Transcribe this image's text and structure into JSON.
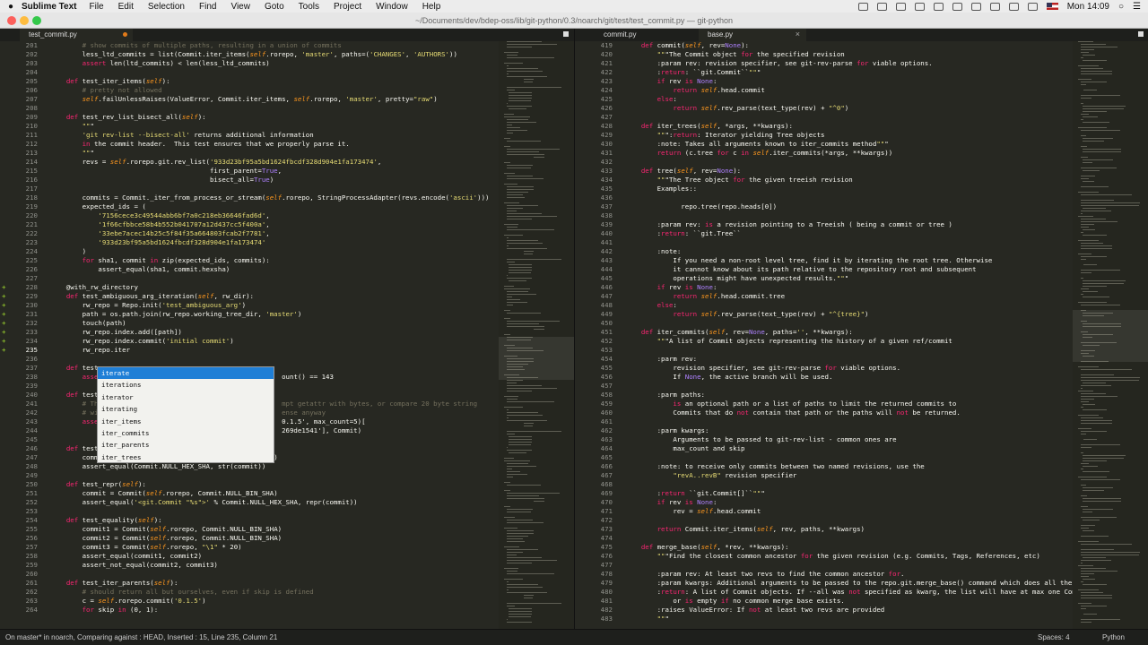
{
  "menubar": {
    "app_name": "Sublime Text",
    "items": [
      "File",
      "Edit",
      "Selection",
      "Find",
      "View",
      "Goto",
      "Tools",
      "Project",
      "Window",
      "Help"
    ],
    "clock": "Mon 14:09"
  },
  "window": {
    "title": "~/Documents/dev/bdep-oss/lib/git-python/0.3/noarch/git/test/test_commit.py — git-python"
  },
  "left_pane": {
    "tab": "test_commit.py",
    "lines": [
      [
        "201",
        "        # show commits of multiple paths, resulting in a union of commits",
        ""
      ],
      [
        "202",
        "        less_ltd_commits = list(Commit.iter_items(self.rorepo, 'master', paths=('CHANGES', 'AUTHORS'))",
        ""
      ],
      [
        "203",
        "        assert len(ltd_commits) < len(less_ltd_commits)",
        ""
      ],
      [
        "204",
        "",
        ""
      ],
      [
        "205",
        "    def test_iter_items(self):",
        ""
      ],
      [
        "206",
        "        # pretty not allowed",
        ""
      ],
      [
        "207",
        "        self.failUnlessRaises(ValueError, Commit.iter_items, self.rorepo, 'master', pretty=\"raw\")",
        ""
      ],
      [
        "208",
        "",
        ""
      ],
      [
        "209",
        "    def test_rev_list_bisect_all(self):",
        ""
      ],
      [
        "210",
        "        \"\"\"",
        ""
      ],
      [
        "211",
        "        'git rev-list --bisect-all' returns additional information",
        ""
      ],
      [
        "212",
        "        in the commit header.  This test ensures that we properly parse it.",
        ""
      ],
      [
        "213",
        "        \"\"\"",
        ""
      ],
      [
        "214",
        "        revs = self.rorepo.git.rev_list('933d23bf95a5bd1624fbcdf328d904e1fa173474',",
        ""
      ],
      [
        "215",
        "                                        first_parent=True,",
        ""
      ],
      [
        "216",
        "                                        bisect_all=True)",
        ""
      ],
      [
        "217",
        "",
        ""
      ],
      [
        "218",
        "        commits = Commit._iter_from_process_or_stream(self.rorepo, StringProcessAdapter(revs.encode('ascii')))",
        ""
      ],
      [
        "219",
        "        expected_ids = (",
        ""
      ],
      [
        "220",
        "            '7156cece3c49544abb6bf7a0c218eb36646fad6d',",
        ""
      ],
      [
        "221",
        "            '1f66cfbbce58b4b552b041707a12d437cc5f400a',",
        ""
      ],
      [
        "222",
        "            '33ebe7acec14b25c5f84f35a664803fcab2f7781',",
        ""
      ],
      [
        "223",
        "            '933d23bf95a5bd1624fbcdf328d904e1fa173474'",
        ""
      ],
      [
        "224",
        "        )",
        ""
      ],
      [
        "225",
        "        for sha1, commit in zip(expected_ids, commits):",
        ""
      ],
      [
        "226",
        "            assert_equal(sha1, commit.hexsha)",
        ""
      ],
      [
        "227",
        "",
        ""
      ],
      [
        "228",
        "    @with_rw_directory",
        "mod"
      ],
      [
        "229",
        "    def test_ambiguous_arg_iteration(self, rw_dir):",
        "mod"
      ],
      [
        "230",
        "        rw_repo = Repo.init('test_ambiguous_arg')",
        "mod"
      ],
      [
        "231",
        "        path = os.path.join(rw_repo.working_tree_dir, 'master')",
        "mod"
      ],
      [
        "232",
        "        touch(path)",
        "mod"
      ],
      [
        "233",
        "        rw_repo.index.add([path])",
        "mod"
      ],
      [
        "234",
        "        rw_repo.index.commit('initial commit')",
        "mod"
      ],
      [
        "235",
        "        rw_repo.iter",
        "mod cur"
      ],
      [
        "236",
        "",
        ""
      ],
      [
        "237",
        "    def test_co",
        ""
      ],
      [
        "238",
        "        assert                                            ount() == 143",
        ""
      ],
      [
        "239",
        "",
        ""
      ],
      [
        "240",
        "    def test_li",
        ""
      ],
      [
        "241",
        "        # This                                            mpt getattr with bytes, or compare 20 byte string",
        ""
      ],
      [
        "242",
        "        # with                                            ense anyway",
        ""
      ],
      [
        "243",
        "        assert                                            0.1.5', max_count=5)[",
        ""
      ],
      [
        "244",
        "                                                          269de1541'], Commit)",
        ""
      ],
      [
        "245",
        "",
        ""
      ],
      [
        "246",
        "    def test_st",
        ""
      ],
      [
        "247",
        "        commit = Commit(self.rorepo, Commit.NULL_BIN_SHA)",
        ""
      ],
      [
        "248",
        "        assert_equal(Commit.NULL_HEX_SHA, str(commit))",
        ""
      ],
      [
        "249",
        "",
        ""
      ],
      [
        "250",
        "    def test_repr(self):",
        ""
      ],
      [
        "251",
        "        commit = Commit(self.rorepo, Commit.NULL_BIN_SHA)",
        ""
      ],
      [
        "252",
        "        assert_equal('<git.Commit \"%s\">' % Commit.NULL_HEX_SHA, repr(commit))",
        ""
      ],
      [
        "253",
        "",
        ""
      ],
      [
        "254",
        "    def test_equality(self):",
        ""
      ],
      [
        "255",
        "        commit1 = Commit(self.rorepo, Commit.NULL_BIN_SHA)",
        ""
      ],
      [
        "256",
        "        commit2 = Commit(self.rorepo, Commit.NULL_BIN_SHA)",
        ""
      ],
      [
        "257",
        "        commit3 = Commit(self.rorepo, \"\\1\" * 20)",
        ""
      ],
      [
        "258",
        "        assert_equal(commit1, commit2)",
        ""
      ],
      [
        "259",
        "        assert_not_equal(commit2, commit3)",
        ""
      ],
      [
        "260",
        "",
        ""
      ],
      [
        "261",
        "    def test_iter_parents(self):",
        ""
      ],
      [
        "262",
        "        # should return all but ourselves, even if skip is defined",
        ""
      ],
      [
        "263",
        "        c = self.rorepo.commit('0.1.5')",
        ""
      ],
      [
        "264",
        "        for skip in (0, 1):",
        ""
      ]
    ]
  },
  "autocomplete": {
    "items": [
      "iterate",
      "iterations",
      "iterator",
      "iterating",
      "iter_items",
      "iter_commits",
      "iter_parents",
      "iter_trees"
    ]
  },
  "right_pane": {
    "tab_1": "commit.py",
    "tab_2": "base.py",
    "lines": [
      [
        "419",
        "    def commit(self, rev=None):"
      ],
      [
        "420",
        "        \"\"\"The Commit object for the specified revision"
      ],
      [
        "421",
        "        :param rev: revision specifier, see git-rev-parse for viable options."
      ],
      [
        "422",
        "        :return: ``git.Commit``\"\"\""
      ],
      [
        "423",
        "        if rev is None:"
      ],
      [
        "424",
        "            return self.head.commit"
      ],
      [
        "425",
        "        else:"
      ],
      [
        "426",
        "            return self.rev_parse(text_type(rev) + \"^0\")"
      ],
      [
        "427",
        ""
      ],
      [
        "428",
        "    def iter_trees(self, *args, **kwargs):"
      ],
      [
        "429",
        "        \"\"\":return: Iterator yielding Tree objects"
      ],
      [
        "430",
        "        :note: Takes all arguments known to iter_commits method\"\"\""
      ],
      [
        "431",
        "        return (c.tree for c in self.iter_commits(*args, **kwargs))"
      ],
      [
        "432",
        ""
      ],
      [
        "433",
        "    def tree(self, rev=None):"
      ],
      [
        "434",
        "        \"\"\"The Tree object for the given treeish revision"
      ],
      [
        "435",
        "        Examples::"
      ],
      [
        "436",
        ""
      ],
      [
        "437",
        "              repo.tree(repo.heads[0])"
      ],
      [
        "438",
        ""
      ],
      [
        "439",
        "        :param rev: is a revision pointing to a Treeish ( being a commit or tree )"
      ],
      [
        "440",
        "        :return: ``git.Tree``"
      ],
      [
        "441",
        ""
      ],
      [
        "442",
        "        :note:"
      ],
      [
        "443",
        "            If you need a non-root level tree, find it by iterating the root tree. Otherwise"
      ],
      [
        "444",
        "            it cannot know about its path relative to the repository root and subsequent"
      ],
      [
        "445",
        "            operations might have unexpected results.\"\"\""
      ],
      [
        "446",
        "        if rev is None:"
      ],
      [
        "447",
        "            return self.head.commit.tree"
      ],
      [
        "448",
        "        else:"
      ],
      [
        "449",
        "            return self.rev_parse(text_type(rev) + \"^{tree}\")"
      ],
      [
        "450",
        ""
      ],
      [
        "451",
        "    def iter_commits(self, rev=None, paths='', **kwargs):"
      ],
      [
        "452",
        "        \"\"\"A list of Commit objects representing the history of a given ref/commit"
      ],
      [
        "453",
        ""
      ],
      [
        "454",
        "        :parm rev:"
      ],
      [
        "455",
        "            revision specifier, see git-rev-parse for viable options."
      ],
      [
        "456",
        "            If None, the active branch will be used."
      ],
      [
        "457",
        ""
      ],
      [
        "458",
        "        :parm paths:"
      ],
      [
        "459",
        "            is an optional path or a list of paths to limit the returned commits to"
      ],
      [
        "460",
        "            Commits that do not contain that path or the paths will not be returned."
      ],
      [
        "461",
        ""
      ],
      [
        "462",
        "        :parm kwargs:"
      ],
      [
        "463",
        "            Arguments to be passed to git-rev-list - common ones are"
      ],
      [
        "464",
        "            max_count and skip"
      ],
      [
        "465",
        ""
      ],
      [
        "466",
        "        :note: to receive only commits between two named revisions, use the"
      ],
      [
        "467",
        "            \"revA..revB\" revision specifier"
      ],
      [
        "468",
        ""
      ],
      [
        "469",
        "        :return ``git.Commit[]``\"\"\""
      ],
      [
        "470",
        "        if rev is None:"
      ],
      [
        "471",
        "            rev = self.head.commit"
      ],
      [
        "472",
        ""
      ],
      [
        "473",
        "        return Commit.iter_items(self, rev, paths, **kwargs)"
      ],
      [
        "474",
        ""
      ],
      [
        "475",
        "    def merge_base(self, *rev, **kwargs):"
      ],
      [
        "476",
        "        \"\"\"Find the closest common ancestor for the given revision (e.g. Commits, Tags, References, etc)"
      ],
      [
        "477",
        ""
      ],
      [
        "478",
        "        :param rev: At least two revs to find the common ancestor for."
      ],
      [
        "479",
        "        :param kwargs: Additional arguments to be passed to the repo.git.merge_base() command which does all the work."
      ],
      [
        "480",
        "        :return: A list of Commit objects. If --all was not specified as kwarg, the list will have at max one Commit,"
      ],
      [
        "481",
        "            or is empty if no common merge base exists."
      ],
      [
        "482",
        "        :raises ValueError: If not at least two revs are provided"
      ],
      [
        "483",
        "        \"\"\""
      ]
    ]
  },
  "statusbar": {
    "left": "On master* in noarch, Comparing against : HEAD, Inserted : 15, Line 235, Column 21",
    "spaces": "Spaces: 4",
    "syntax": "Python"
  },
  "colors": {
    "editor_bg": "#272822",
    "keyword": "#f92672",
    "function": "#a6e22e",
    "string": "#e6db74",
    "comment": "#75715e",
    "accent_blue": "#1f7fd6"
  }
}
